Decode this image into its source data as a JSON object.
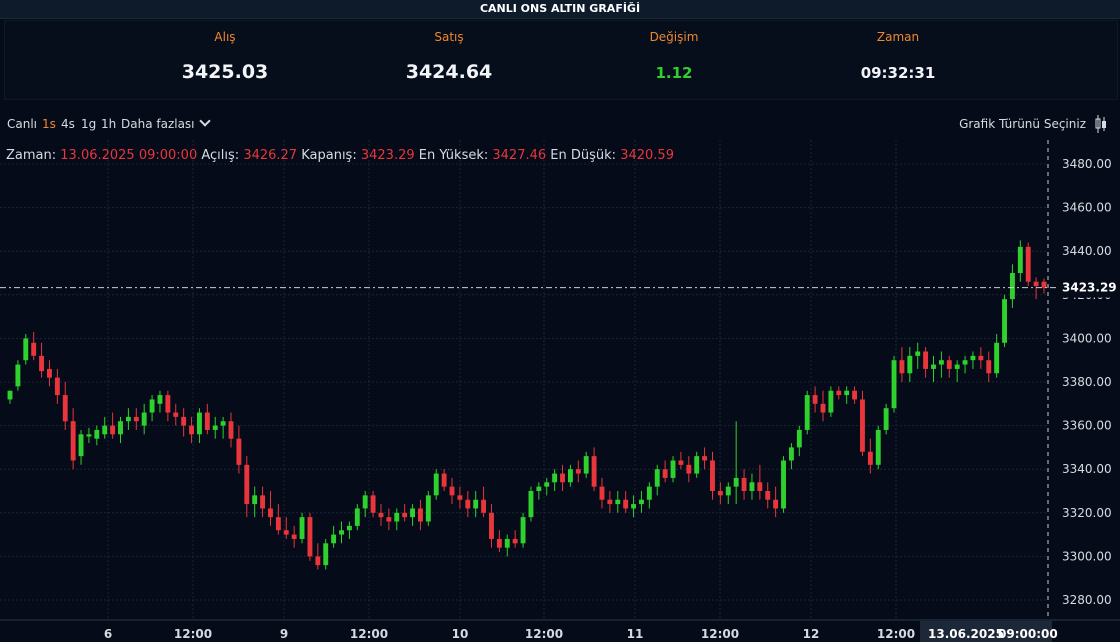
{
  "header": {
    "title": "CANLI ONS ALTIN GRAFİĞİ"
  },
  "quotes": [
    {
      "label": "Alış",
      "value": "3425.03"
    },
    {
      "label": "Satış",
      "value": "3424.64"
    },
    {
      "label": "Değişim",
      "value": "1.12"
    },
    {
      "label": "Zaman",
      "value": "09:32:31"
    }
  ],
  "colors": {
    "accent": "#f0872e",
    "up": "#2ed12e",
    "down": "#e8363c"
  },
  "toolbar": {
    "live": "Canlı",
    "intervals": [
      "1s",
      "4s",
      "1g",
      "1h"
    ],
    "active_interval": "1s",
    "more": "Daha fazlası",
    "chart_type": "Grafik Türünü Seçiniz"
  },
  "ohlc": {
    "time_label": "Zaman:",
    "time_value": "13.06.2025 09:00:00",
    "open_label": "Açılış:",
    "open_value": "3426.27",
    "close_label": "Kapanış:",
    "close_value": "3423.29",
    "high_label": "En Yüksek:",
    "high_value": "3427.46",
    "low_label": "En Düşük:",
    "low_value": "3420.59"
  },
  "chart_data": {
    "type": "candlestick",
    "title": "",
    "ylim": [
      3270,
      3490
    ],
    "yticks": [
      "3480.00",
      "3460.00",
      "3440.00",
      "3420.00",
      "3400.00",
      "3380.00",
      "3360.00",
      "3340.00",
      "3320.00",
      "3300.00",
      "3280.00"
    ],
    "xticks": [
      "6",
      "12:00",
      "9",
      "12:00",
      "10",
      "12:00",
      "11",
      "12:00",
      "12",
      "12:00"
    ],
    "crosshair_time": "13.06.2025",
    "crosshair_time2": "09:00:00",
    "crosshair_price": "3423.29",
    "candles": [
      [
        3372,
        3376,
        3370,
        3376
      ],
      [
        3378,
        3390,
        3376,
        3388
      ],
      [
        3390,
        3402,
        3388,
        3400
      ],
      [
        3398,
        3403,
        3390,
        3392
      ],
      [
        3392,
        3398,
        3382,
        3385
      ],
      [
        3386,
        3390,
        3378,
        3382
      ],
      [
        3382,
        3386,
        3370,
        3374
      ],
      [
        3374,
        3380,
        3358,
        3362
      ],
      [
        3362,
        3368,
        3340,
        3344
      ],
      [
        3346,
        3358,
        3342,
        3356
      ],
      [
        3355,
        3359,
        3352,
        3356
      ],
      [
        3354,
        3360,
        3351,
        3358
      ],
      [
        3356,
        3364,
        3354,
        3360
      ],
      [
        3360,
        3366,
        3354,
        3356
      ],
      [
        3356,
        3364,
        3352,
        3362
      ],
      [
        3362,
        3368,
        3358,
        3364
      ],
      [
        3364,
        3368,
        3358,
        3362
      ],
      [
        3360,
        3370,
        3356,
        3366
      ],
      [
        3366,
        3374,
        3362,
        3372
      ],
      [
        3370,
        3376,
        3366,
        3374
      ],
      [
        3374,
        3376,
        3362,
        3366
      ],
      [
        3366,
        3370,
        3360,
        3364
      ],
      [
        3364,
        3368,
        3355,
        3360
      ],
      [
        3360,
        3364,
        3352,
        3356
      ],
      [
        3356,
        3368,
        3352,
        3366
      ],
      [
        3366,
        3370,
        3356,
        3358
      ],
      [
        3358,
        3364,
        3354,
        3360
      ],
      [
        3360,
        3364,
        3354,
        3362
      ],
      [
        3362,
        3366,
        3350,
        3354
      ],
      [
        3354,
        3360,
        3338,
        3342
      ],
      [
        3342,
        3346,
        3318,
        3324
      ],
      [
        3324,
        3332,
        3318,
        3328
      ],
      [
        3328,
        3332,
        3318,
        3322
      ],
      [
        3322,
        3330,
        3314,
        3318
      ],
      [
        3318,
        3324,
        3310,
        3312
      ],
      [
        3312,
        3318,
        3308,
        3310
      ],
      [
        3310,
        3314,
        3304,
        3308
      ],
      [
        3308,
        3320,
        3306,
        3318
      ],
      [
        3318,
        3320,
        3298,
        3300
      ],
      [
        3300,
        3306,
        3294,
        3296
      ],
      [
        3296,
        3308,
        3294,
        3306
      ],
      [
        3306,
        3314,
        3304,
        3310
      ],
      [
        3310,
        3316,
        3306,
        3312
      ],
      [
        3312,
        3316,
        3308,
        3314
      ],
      [
        3314,
        3324,
        3312,
        3322
      ],
      [
        3322,
        3330,
        3318,
        3328
      ],
      [
        3328,
        3330,
        3318,
        3320
      ],
      [
        3320,
        3324,
        3314,
        3318
      ],
      [
        3318,
        3322,
        3312,
        3316
      ],
      [
        3316,
        3322,
        3312,
        3320
      ],
      [
        3320,
        3324,
        3316,
        3318
      ],
      [
        3318,
        3324,
        3314,
        3322
      ],
      [
        3322,
        3326,
        3312,
        3316
      ],
      [
        3316,
        3330,
        3314,
        3328
      ],
      [
        3328,
        3340,
        3326,
        3338
      ],
      [
        3338,
        3340,
        3330,
        3332
      ],
      [
        3332,
        3336,
        3324,
        3328
      ],
      [
        3328,
        3332,
        3322,
        3326
      ],
      [
        3326,
        3330,
        3318,
        3322
      ],
      [
        3322,
        3330,
        3318,
        3326
      ],
      [
        3326,
        3332,
        3318,
        3320
      ],
      [
        3320,
        3324,
        3304,
        3308
      ],
      [
        3308,
        3312,
        3302,
        3304
      ],
      [
        3304,
        3310,
        3300,
        3308
      ],
      [
        3308,
        3312,
        3304,
        3306
      ],
      [
        3306,
        3320,
        3304,
        3318
      ],
      [
        3318,
        3332,
        3316,
        3330
      ],
      [
        3330,
        3334,
        3326,
        3332
      ],
      [
        3332,
        3336,
        3328,
        3334
      ],
      [
        3334,
        3340,
        3330,
        3338
      ],
      [
        3338,
        3342,
        3330,
        3334
      ],
      [
        3334,
        3342,
        3332,
        3340
      ],
      [
        3340,
        3344,
        3334,
        3338
      ],
      [
        3338,
        3348,
        3336,
        3346
      ],
      [
        3346,
        3350,
        3330,
        3332
      ],
      [
        3332,
        3336,
        3322,
        3326
      ],
      [
        3326,
        3330,
        3320,
        3324
      ],
      [
        3324,
        3330,
        3320,
        3326
      ],
      [
        3326,
        3330,
        3320,
        3322
      ],
      [
        3322,
        3328,
        3318,
        3324
      ],
      [
        3324,
        3330,
        3320,
        3326
      ],
      [
        3326,
        3334,
        3322,
        3332
      ],
      [
        3332,
        3342,
        3328,
        3340
      ],
      [
        3340,
        3344,
        3334,
        3336
      ],
      [
        3336,
        3346,
        3334,
        3344
      ],
      [
        3344,
        3348,
        3340,
        3342
      ],
      [
        3342,
        3346,
        3334,
        3338
      ],
      [
        3338,
        3348,
        3336,
        3346
      ],
      [
        3346,
        3350,
        3340,
        3344
      ],
      [
        3344,
        3348,
        3326,
        3330
      ],
      [
        3330,
        3334,
        3324,
        3328
      ],
      [
        3328,
        3334,
        3324,
        3332
      ],
      [
        3332,
        3362,
        3324,
        3336
      ],
      [
        3336,
        3340,
        3326,
        3330
      ],
      [
        3330,
        3338,
        3326,
        3334
      ],
      [
        3334,
        3342,
        3326,
        3330
      ],
      [
        3330,
        3334,
        3322,
        3326
      ],
      [
        3326,
        3332,
        3318,
        3322
      ],
      [
        3322,
        3346,
        3320,
        3344
      ],
      [
        3344,
        3352,
        3340,
        3350
      ],
      [
        3350,
        3360,
        3346,
        3358
      ],
      [
        3358,
        3376,
        3356,
        3374
      ],
      [
        3374,
        3378,
        3366,
        3370
      ],
      [
        3370,
        3376,
        3362,
        3366
      ],
      [
        3366,
        3378,
        3364,
        3376
      ],
      [
        3376,
        3378,
        3372,
        3374
      ],
      [
        3374,
        3378,
        3370,
        3376
      ],
      [
        3376,
        3378,
        3370,
        3372
      ],
      [
        3372,
        3376,
        3346,
        3348
      ],
      [
        3348,
        3354,
        3338,
        3342
      ],
      [
        3342,
        3360,
        3340,
        3358
      ],
      [
        3358,
        3370,
        3356,
        3368
      ],
      [
        3368,
        3392,
        3366,
        3390
      ],
      [
        3390,
        3396,
        3380,
        3384
      ],
      [
        3384,
        3396,
        3380,
        3392
      ],
      [
        3392,
        3398,
        3386,
        3394
      ],
      [
        3394,
        3396,
        3382,
        3386
      ],
      [
        3386,
        3392,
        3380,
        3388
      ],
      [
        3388,
        3394,
        3382,
        3390
      ],
      [
        3390,
        3392,
        3382,
        3386
      ],
      [
        3386,
        3390,
        3380,
        3388
      ],
      [
        3388,
        3392,
        3384,
        3390
      ],
      [
        3390,
        3394,
        3386,
        3392
      ],
      [
        3392,
        3396,
        3386,
        3390
      ],
      [
        3390,
        3394,
        3380,
        3384
      ],
      [
        3384,
        3402,
        3382,
        3398
      ],
      [
        3398,
        3420,
        3396,
        3418
      ],
      [
        3418,
        3434,
        3414,
        3430
      ],
      [
        3430,
        3445,
        3426,
        3442
      ],
      [
        3442,
        3444,
        3424,
        3426
      ],
      [
        3426,
        3428,
        3418,
        3424
      ],
      [
        3426,
        3427.46,
        3420.59,
        3423.29
      ]
    ]
  }
}
